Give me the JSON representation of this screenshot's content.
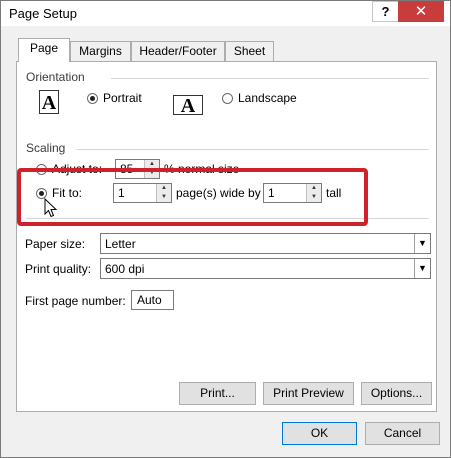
{
  "window": {
    "title": "Page Setup",
    "help_label": "?",
    "close_label": "✕"
  },
  "tabs": [
    {
      "label": "Page",
      "active": true
    },
    {
      "label": "Margins",
      "active": false
    },
    {
      "label": "Header/Footer",
      "active": false
    },
    {
      "label": "Sheet",
      "active": false
    }
  ],
  "orientation": {
    "heading": "Orientation",
    "portrait_label": "Portrait",
    "landscape_label": "Landscape",
    "portrait_glyph": "A",
    "landscape_glyph": "A",
    "selected": "portrait"
  },
  "scaling": {
    "heading": "Scaling",
    "adjust_label": "Adjust to:",
    "adjust_value": "85",
    "adjust_suffix": "% normal size",
    "fit_label": "Fit to:",
    "fit_wide_value": "1",
    "fit_mid_label": "page(s) wide by",
    "fit_tall_value": "1",
    "fit_tall_label": "tall",
    "selected": "fit"
  },
  "paper_size": {
    "label": "Paper size:",
    "value": "Letter"
  },
  "print_quality": {
    "label": "Print quality:",
    "value": "600 dpi"
  },
  "first_page": {
    "label": "First page number:",
    "value": "Auto"
  },
  "buttons": {
    "print": "Print...",
    "print_preview": "Print Preview",
    "options": "Options...",
    "ok": "OK",
    "cancel": "Cancel"
  },
  "colors": {
    "highlight": "#d0202a",
    "close_button": "#c83c3c",
    "default_button_border": "#0078d7"
  }
}
